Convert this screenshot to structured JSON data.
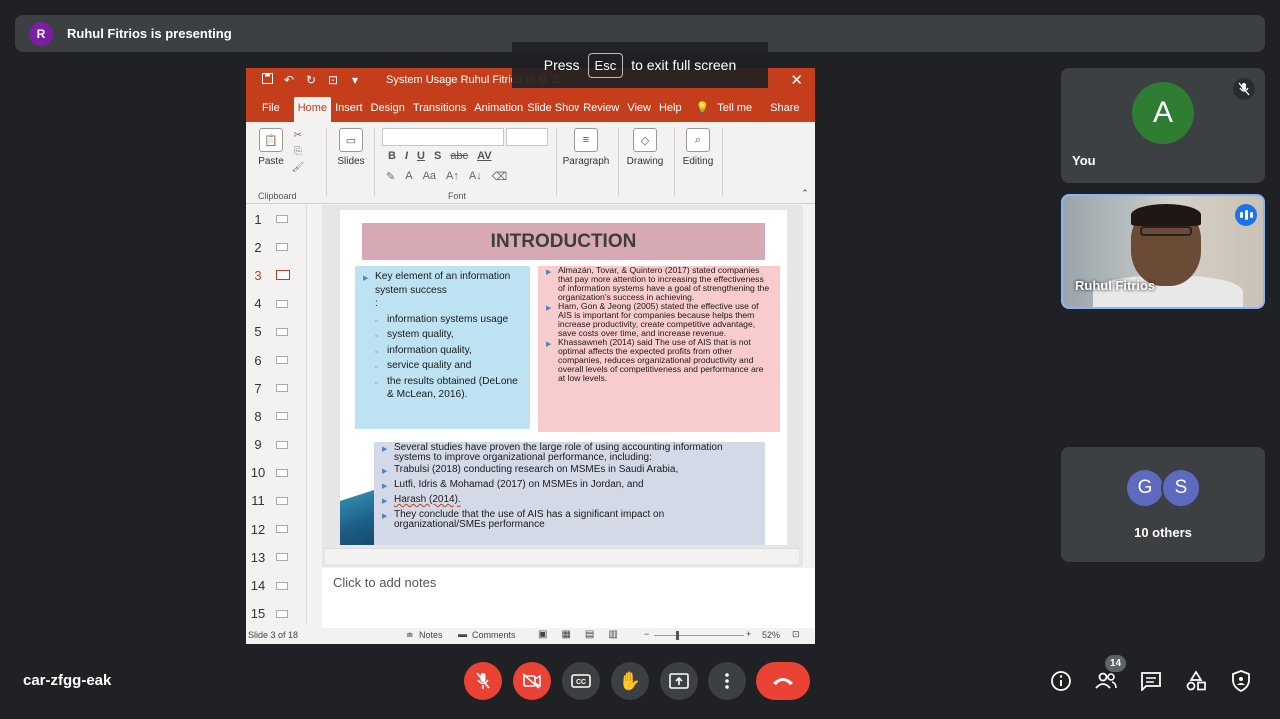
{
  "presenting_bar": {
    "avatar_letter": "R",
    "text": "Ruhul Fitrios is presenting"
  },
  "fullscreen_hint": {
    "press": "Press",
    "key": "Esc",
    "rest": "to exit full screen"
  },
  "ppt": {
    "doc_title": "System Usage Ruhul Fitrios et al. 2...",
    "menu_tabs": [
      "File",
      "Home",
      "Insert",
      "Design",
      "Transitions",
      "Animations",
      "Slide Show",
      "Review",
      "View",
      "Help"
    ],
    "tell_me": "Tell me",
    "share": "Share",
    "ribbon": {
      "paste": "Paste",
      "slides": "Slides",
      "paragraph": "Paragraph",
      "drawing": "Drawing",
      "editing": "Editing",
      "clipboard_label": "Clipboard",
      "font_label": "Font"
    },
    "thumbnail_numbers": [
      "1",
      "2",
      "3",
      "4",
      "5",
      "6",
      "7",
      "8",
      "9",
      "10",
      "11",
      "12",
      "13",
      "14",
      "15"
    ],
    "selected_slide": 3,
    "slide": {
      "title": "INTRODUCTION",
      "left_box": {
        "lead": "Key element of an information system success",
        "colon": ":",
        "items": [
          "information systems usage",
          "system quality,",
          "information quality,",
          "service quality and",
          "the results obtained (DeLone & McLean, 2016)."
        ]
      },
      "right_box": [
        "Almazán, Tovar, & Quintero (2017) stated companies that pay more attention to increasing the effectiveness of information systems have a goal of strengthening the organization's success in achieving.",
        "Ham, Gon & Jeong (2005) stated the effective use of AIS is important for companies because helps them increase productivity, create competitive advantage, save costs over time, and increase revenue.",
        "Khassawneh (2014) said The use of AIS that is not optimal affects the expected profits from other companies, reduces organizational productivity and overall levels of competitiveness and performance are at low levels."
      ],
      "bottom_box": [
        "Several studies have proven the large role of using accounting information systems to improve organizational performance, including:",
        "Trabulsi (2018) conducting research on MSMEs in Saudi Arabia,",
        "Lutfi, Idris & Mohamad (2017) on MSMEs in Jordan, and",
        "Harash (2014).",
        "They conclude that the use of AIS has a significant impact on organizational/SMEs performance"
      ]
    },
    "notes_placeholder": "Click to add notes",
    "status": {
      "slide_of": "Slide 3 of 18",
      "notes": "Notes",
      "comments": "Comments",
      "zoom": "52%"
    }
  },
  "tiles": {
    "you": {
      "letter": "A",
      "label": "You"
    },
    "presenter": {
      "label": "Ruhul Fitrios"
    },
    "others": {
      "letters": [
        "G",
        "S"
      ],
      "label": "10 others"
    }
  },
  "bottom": {
    "meeting_code": "car-zfgg-eak",
    "people_count": "14"
  },
  "colors": {
    "ppt_accent": "#c43e1c",
    "meet_bg": "#202124",
    "tile_bg": "#3c4043",
    "danger": "#ea4335",
    "speaking": "#1a73e8"
  }
}
